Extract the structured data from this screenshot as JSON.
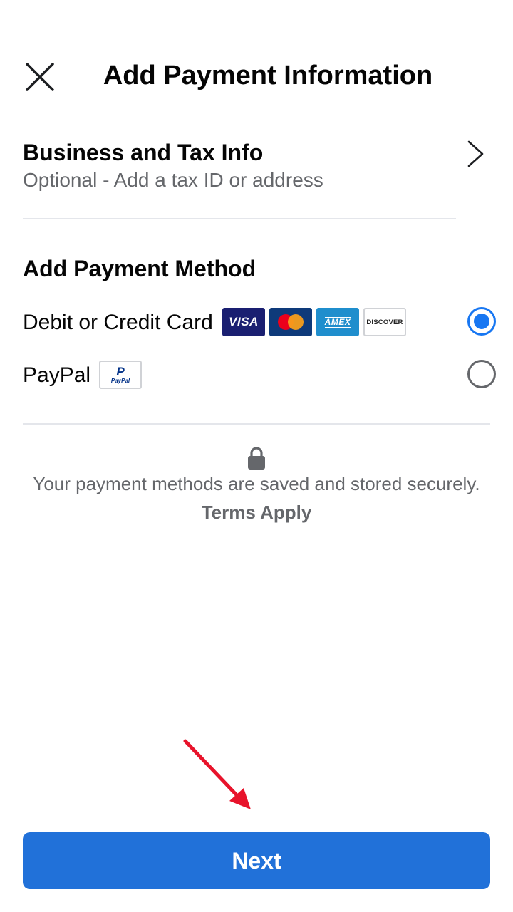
{
  "header": {
    "title": "Add Payment Information",
    "close_icon": "close-icon"
  },
  "business": {
    "title": "Business and Tax Info",
    "subtitle": "Optional - Add a tax ID or address",
    "chevron_icon": "chevron-right-icon"
  },
  "payment": {
    "section_title": "Add Payment Method",
    "options": [
      {
        "label": "Debit or Credit Card",
        "selected": true,
        "logos": [
          {
            "name": "visa",
            "text": "VISA"
          },
          {
            "name": "mastercard",
            "text": ""
          },
          {
            "name": "amex",
            "text": "AMEX"
          },
          {
            "name": "discover",
            "text": "DISCOVER"
          }
        ]
      },
      {
        "label": "PayPal",
        "selected": false,
        "logos": [
          {
            "name": "paypal",
            "text": "PayPal"
          }
        ]
      }
    ]
  },
  "security": {
    "lock_icon": "lock-icon",
    "message": "Your payment methods are saved and stored securely.",
    "terms_link": "Terms Apply"
  },
  "footer": {
    "next_label": "Next"
  },
  "colors": {
    "primary": "#2171d9",
    "radio_selected": "#1877f2",
    "secondary_text": "#65676b",
    "divider": "#e4e6eb",
    "annotation_arrow": "#e8132b"
  }
}
